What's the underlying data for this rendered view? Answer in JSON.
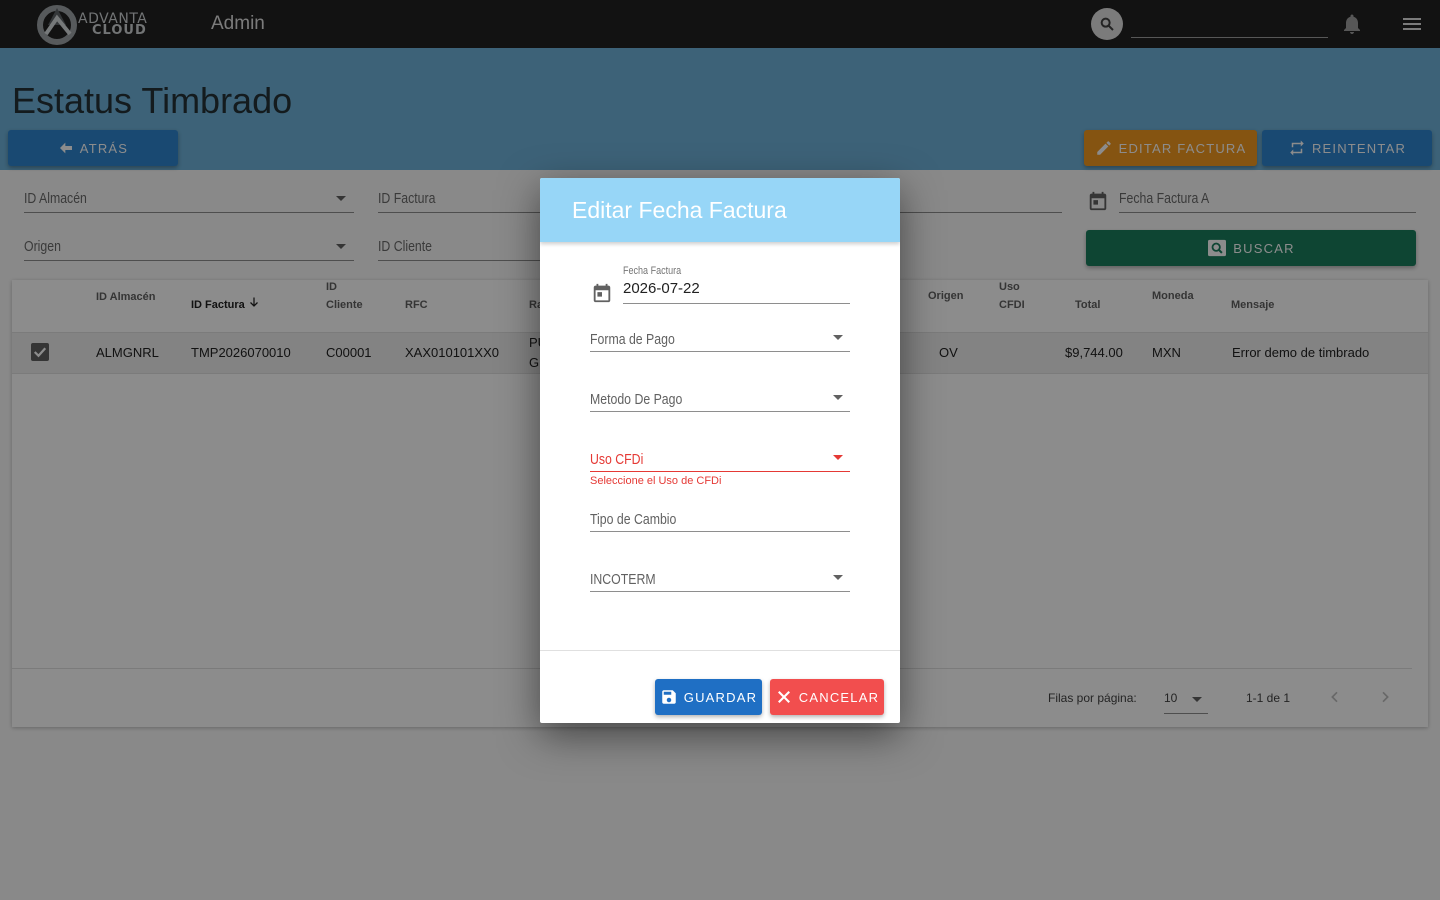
{
  "app": {
    "brand_line1": "ADVANTA",
    "brand_line2": "CLOUD",
    "title": "Admin"
  },
  "page": {
    "title": "Estatus Timbrado"
  },
  "actions": {
    "back": "ATRÁS",
    "edit": "EDITAR FACTURA",
    "retry": "REINTENTAR",
    "search": "BUSCAR"
  },
  "filters": {
    "almacen": "ID Almacén",
    "factura": "ID Factura",
    "origen": "Origen",
    "cliente": "ID Cliente",
    "fecha_a": "Fecha Factura A"
  },
  "table": {
    "headers": {
      "almacen": "ID Almacén",
      "factura": "ID Factura",
      "cliente_1": "ID",
      "cliente_2": "Cliente",
      "rfc": "RFC",
      "razon": "Ra",
      "origen": "Origen",
      "uso_1": "Uso",
      "uso_2": "CFDI",
      "total": "Total",
      "moneda": "Moneda",
      "mensaje": "Mensaje"
    },
    "rows": [
      {
        "almacen": "ALMGNRL",
        "factura": "TMP2026070010",
        "cliente": "C00001",
        "rfc": "XAX010101XX0",
        "razon_1": "PU",
        "razon_2": "GI",
        "origen": "OV",
        "total": "$9,744.00",
        "moneda": "MXN",
        "mensaje": "Error demo de timbrado"
      }
    ],
    "footer": {
      "rows_label": "Filas por página:",
      "rows_value": "10",
      "range": "1-1 de 1"
    }
  },
  "dialog": {
    "title": "Editar Fecha Factura",
    "fecha_label": "Fecha Factura",
    "fecha_value": "2026-07-22",
    "forma_pago": "Forma de Pago",
    "metodo_pago": "Metodo De Pago",
    "uso_cfdi": "Uso CFDi",
    "uso_cfdi_error": "Seleccione el Uso de CFDi",
    "tipo_cambio": "Tipo de Cambio",
    "incoterm": "INCOTERM",
    "save": "GUARDAR",
    "cancel": "CANCELAR"
  },
  "colors": {
    "band": "#6fb3da",
    "edit": "#f39a1f",
    "retry": "#2f86d0",
    "buscar": "#1a7f5e",
    "dialog_head": "#97d6f7",
    "error": "#e53935",
    "save": "#1f6fc4",
    "cancel": "#f24e4e"
  }
}
